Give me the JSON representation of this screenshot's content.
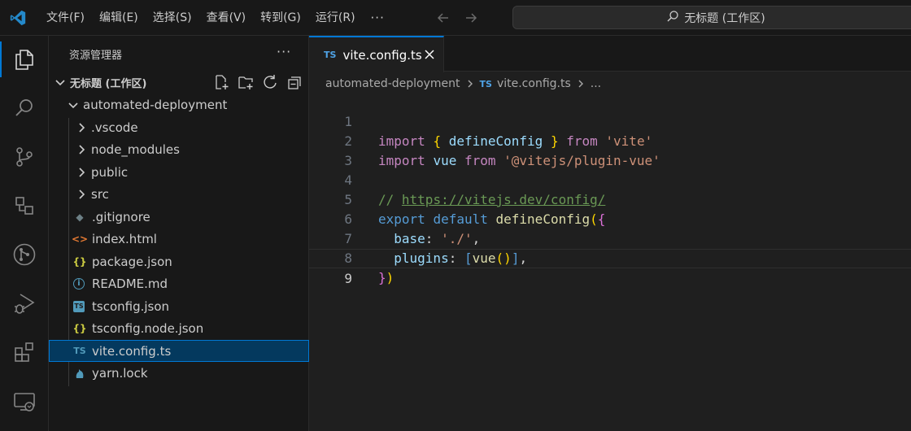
{
  "title_bar": {
    "menu": [
      "文件(F)",
      "编辑(E)",
      "选择(S)",
      "查看(V)",
      "转到(G)",
      "运行(R)"
    ],
    "more": "···",
    "search_text": "无标题 (工作区)"
  },
  "activity_bar": {
    "icons": [
      "explorer-icon",
      "search-icon",
      "source-control-icon",
      "remote-explorer-icon",
      "git-graph-icon",
      "run-debug-icon",
      "extensions-icon",
      "remote-icon"
    ]
  },
  "sidebar": {
    "title": "资源管理器",
    "more": "···",
    "workspace": "无标题 (工作区)",
    "root_folder": "automated-deployment",
    "folders": [
      ".vscode",
      "node_modules",
      "public",
      "src"
    ],
    "files": [
      {
        "name": ".gitignore",
        "icon": "git-icon",
        "glyph": "◆",
        "color": "#6d8086"
      },
      {
        "name": "index.html",
        "icon": "html-icon",
        "glyph": "<>",
        "color": "#e37933"
      },
      {
        "name": "package.json",
        "icon": "json-icon",
        "glyph": "{}",
        "color": "#cbcb41"
      },
      {
        "name": "README.md",
        "icon": "info-icon",
        "glyph": "i",
        "color": "#519aba"
      },
      {
        "name": "tsconfig.json",
        "icon": "tsconfig-icon",
        "glyph": "TS",
        "color": "#519aba"
      },
      {
        "name": "tsconfig.node.json",
        "icon": "json-icon",
        "glyph": "{}",
        "color": "#cbcb41"
      },
      {
        "name": "vite.config.ts",
        "icon": "typescript-icon",
        "glyph": "TS",
        "color": "#519aba"
      },
      {
        "name": "yarn.lock",
        "icon": "yarn-icon",
        "glyph": "🐈",
        "color": "#519aba"
      }
    ],
    "selected_file": "vite.config.ts"
  },
  "editor": {
    "tab": {
      "badge": "TS",
      "label": "vite.config.ts"
    },
    "breadcrumb": {
      "folder": "automated-deployment",
      "badge": "TS",
      "file": "vite.config.ts",
      "more": "..."
    },
    "line_numbers": [
      "1",
      "2",
      "3",
      "4",
      "5",
      "6",
      "7",
      "8",
      "9"
    ],
    "code": {
      "l1": [
        "import",
        "{",
        "defineConfig",
        "}",
        "from",
        "'vite'"
      ],
      "l2": [
        "import",
        "vue",
        "from",
        "'@vitejs/plugin-vue'"
      ],
      "l4": [
        "//",
        "https://vitejs.dev/config/"
      ],
      "l5": [
        "export",
        "default",
        "defineConfig",
        "(",
        "{"
      ],
      "l6": [
        "base",
        ":",
        "'./'",
        ","
      ],
      "l7": [
        "plugins",
        ":",
        "[",
        "vue",
        "(",
        ")",
        "]",
        ","
      ],
      "l8": [
        "}",
        ")"
      ]
    },
    "current_line": "9"
  },
  "colors": {
    "accent": "#0078d4",
    "selection": "#04395e",
    "keyword": "#c586c0",
    "builtin": "#569cd6",
    "function": "#dcdcaa",
    "string": "#ce9178",
    "comment": "#6a9955"
  }
}
